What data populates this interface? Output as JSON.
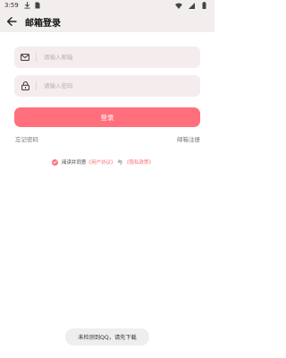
{
  "statusbar": {
    "time": "3:59",
    "icons": [
      "download-icon",
      "signal-icon",
      "wifi-icon",
      "battery-icon"
    ]
  },
  "appbar": {
    "title": "邮箱登录",
    "back_icon": "arrow-left-icon"
  },
  "form": {
    "email": {
      "placeholder": "请输入邮箱",
      "value": "",
      "icon": "mail-icon"
    },
    "password": {
      "placeholder": "请输入密码",
      "value": "",
      "icon": "lock-icon"
    },
    "login_label": "登录"
  },
  "links": {
    "forgot": "忘记密码",
    "register": "邮箱注册"
  },
  "agreement": {
    "checked": true,
    "prefix": "阅读并同意",
    "user_agreement": "《用户协议》",
    "connector": "与",
    "privacy_policy": "《隐私政策》"
  },
  "toast": "未检测到QQ，请先下载",
  "colors": {
    "accent": "#ff6f7c",
    "header_bg": "#f3eeee",
    "field_bg": "#f5eded"
  }
}
